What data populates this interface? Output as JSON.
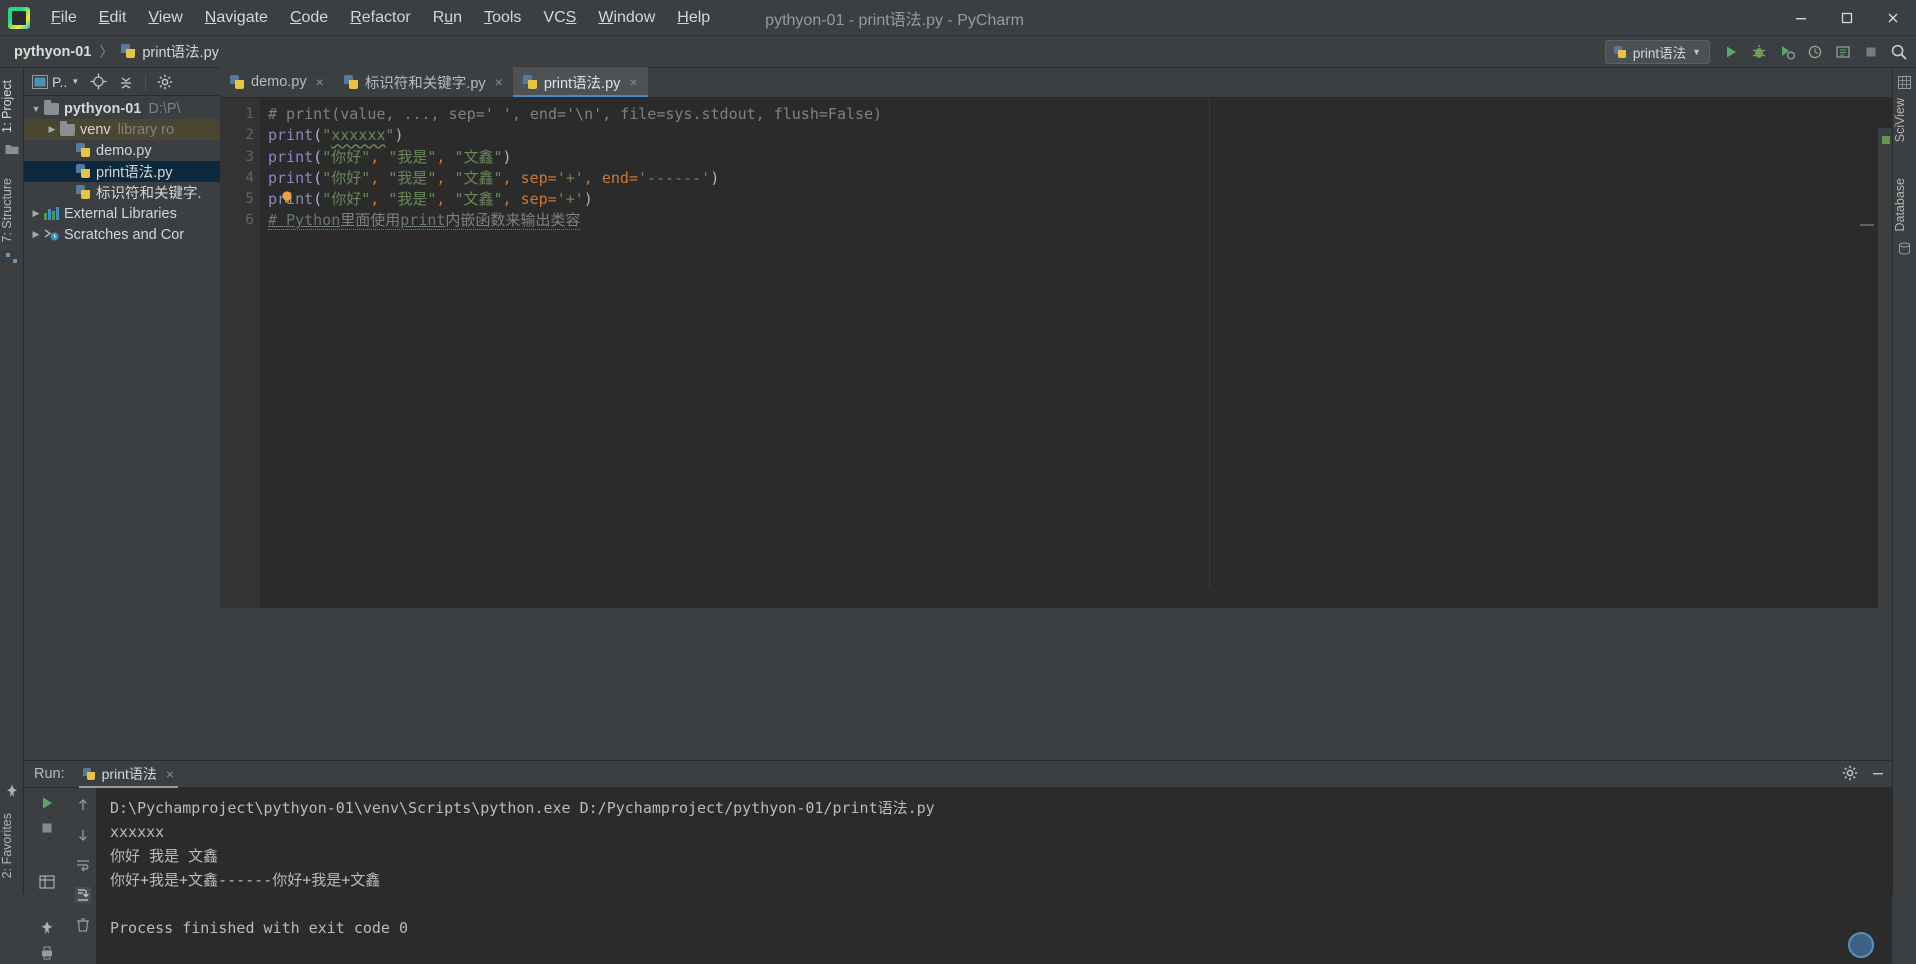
{
  "window": {
    "title": "pythyon-01 - print语法.py - PyCharm",
    "minimize_icon": "minimize-icon",
    "maximize_icon": "maximize-icon",
    "close_icon": "close-icon"
  },
  "menu": {
    "items": [
      {
        "label": "File"
      },
      {
        "label": "Edit"
      },
      {
        "label": "View"
      },
      {
        "label": "Navigate"
      },
      {
        "label": "Code"
      },
      {
        "label": "Refactor"
      },
      {
        "label": "Run"
      },
      {
        "label": "Tools"
      },
      {
        "label": "VCS"
      },
      {
        "label": "Window"
      },
      {
        "label": "Help"
      }
    ]
  },
  "breadcrumb": {
    "project": "pythyon-01",
    "separator": "〉",
    "file": "print语法.py"
  },
  "navbar": {
    "run_config": "print语法",
    "run_config_chevron": "chevron-down-icon",
    "buttons": [
      {
        "name": "run-button",
        "icon": "play-icon"
      },
      {
        "name": "debug-button",
        "icon": "bug-icon"
      },
      {
        "name": "run-coverage-button",
        "icon": "coverage-icon"
      },
      {
        "name": "profile-button",
        "icon": "profile-icon"
      },
      {
        "name": "attach-button",
        "icon": "attach-icon"
      },
      {
        "name": "stop-button",
        "icon": "stop-icon"
      },
      {
        "name": "search-everywhere-button",
        "icon": "search-icon"
      }
    ]
  },
  "left_stripe": {
    "project_label": "1: Project",
    "structure_label": "7: Structure",
    "favorites_label": "2: Favorites"
  },
  "right_stripe": {
    "sciview_label": "SciView",
    "database_label": "Database"
  },
  "project_pane": {
    "toolbar": {
      "view_selector": "P..",
      "view_chevron": "chevron-down-icon",
      "locate_icon": "crosshair-icon",
      "collapse_icon": "collapse-all-icon",
      "settings_icon": "gear-icon"
    },
    "tree": [
      {
        "label": "pythyon-01",
        "sub": "D:\\P\\",
        "indent": 0,
        "expanded": true,
        "icon": "folder-icon",
        "bold": true,
        "state": "normal"
      },
      {
        "label": "venv",
        "sub": "library ro",
        "indent": 1,
        "expanded": false,
        "icon": "folder-icon",
        "bold": false,
        "state": "highlight"
      },
      {
        "label": "demo.py",
        "sub": "",
        "indent": 2,
        "icon": "python-file-icon",
        "bold": false,
        "state": "normal"
      },
      {
        "label": "print语法.py",
        "sub": "",
        "indent": 2,
        "icon": "python-file-icon",
        "bold": false,
        "state": "selected"
      },
      {
        "label": "标识符和关键字.",
        "sub": "",
        "indent": 2,
        "icon": "python-file-icon",
        "bold": false,
        "state": "normal"
      },
      {
        "label": "External Libraries",
        "sub": "",
        "indent": 0,
        "expanded": false,
        "icon": "libraries-icon",
        "bold": false,
        "state": "normal"
      },
      {
        "label": "Scratches and Cor",
        "sub": "",
        "indent": 0,
        "expanded": false,
        "icon": "scratches-icon",
        "bold": false,
        "state": "normal"
      }
    ]
  },
  "editor": {
    "tabs": [
      {
        "label": "demo.py",
        "active": false,
        "close": "×",
        "icon": "python-file-icon"
      },
      {
        "label": "标识符和关键字.py",
        "active": false,
        "close": "×",
        "icon": "python-file-icon"
      },
      {
        "label": "print语法.py",
        "active": true,
        "close": "×",
        "icon": "python-file-icon"
      }
    ],
    "line_numbers": [
      "1",
      "2",
      "3",
      "4",
      "5",
      "6"
    ],
    "lines": [
      {
        "n": 1,
        "text": "# print(value, ..., sep=' ', end='\\n', file=sys.stdout, flush=False)"
      },
      {
        "n": 2,
        "text": "print(\"xxxxxx\")"
      },
      {
        "n": 3,
        "text": "print(\"你好\", \"我是\", \"文鑫\")"
      },
      {
        "n": 4,
        "text": "print(\"你好\", \"我是\", \"文鑫\", sep='+', end='------')"
      },
      {
        "n": 5,
        "text": "print(\"你好\", \"我是\", \"文鑫\", sep='+')"
      },
      {
        "n": 6,
        "text": "# Python里面使用print内嵌函数来输出类容"
      }
    ],
    "intention_bulb": "lightbulb-icon",
    "inspection_status_color": "#629755"
  },
  "run_panel": {
    "label": "Run:",
    "tab": "print语法",
    "tab_close": "×",
    "settings_icon": "gear-icon",
    "hide_icon": "minimize-icon",
    "side_buttons": [
      {
        "name": "rerun-button",
        "icon": "play-icon"
      },
      {
        "name": "stop-button",
        "icon": "stop-icon"
      },
      {
        "name": "pin-tab-button",
        "icon": "pin-icon"
      },
      {
        "name": "up-stack-button",
        "icon": "arrow-up-icon"
      },
      {
        "name": "down-stack-button",
        "icon": "arrow-down-icon"
      },
      {
        "name": "soft-wrap-button",
        "icon": "wrap-icon"
      },
      {
        "name": "scroll-to-end-button",
        "icon": "scroll-end-icon"
      },
      {
        "name": "print-button",
        "icon": "printer-icon"
      },
      {
        "name": "clear-all-button",
        "icon": "trash-icon"
      }
    ],
    "console": [
      "D:\\Pychamproject\\pythyon-01\\venv\\Scripts\\python.exe D:/Pychamproject/pythyon-01/print语法.py",
      "xxxxxx",
      "你好 我是 文鑫",
      "你好+我是+文鑫------你好+我是+文鑫",
      "",
      "Process finished with exit code 0"
    ]
  },
  "colors": {
    "background": "#3c3f41",
    "editor_background": "#2b2b2b",
    "selection": "#0d293e",
    "accent": "#4a88c7",
    "string": "#6a8759",
    "keyword": "#cc7832",
    "comment": "#808080"
  }
}
